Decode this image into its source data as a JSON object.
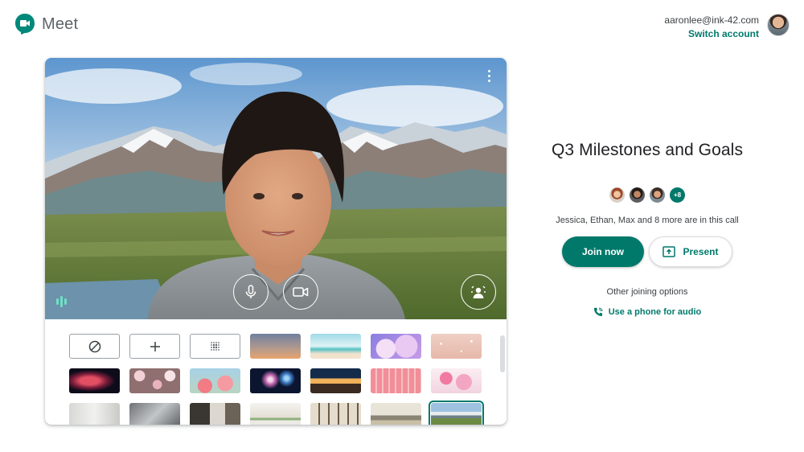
{
  "app": {
    "name": "Meet"
  },
  "account": {
    "email": "aaronlee@ink-42.com",
    "switch_label": "Switch account"
  },
  "preview": {
    "icons": {
      "more": "more-vert-icon",
      "mic": "mic-icon",
      "camera": "videocam-icon",
      "effects": "visual-effects-icon",
      "audio": "audio-level-icon"
    },
    "backgrounds": [
      [
        "no-effect-icon",
        "add-icon",
        "blur-icon",
        "dusk-sky",
        "beach",
        "purple-clouds",
        "pink-sparkles"
      ],
      [
        "nebula",
        "flowers",
        "pink-blossoms",
        "fireworks",
        "night-cabin",
        "pink-pattern",
        "cherry-blossom"
      ],
      [
        "white-room",
        "grey-office",
        "loft",
        "bright-room",
        "shelves",
        "safari",
        "mountains"
      ]
    ],
    "selected_background": "mountains"
  },
  "meeting": {
    "title": "Q3 Milestones and Goals",
    "more_count": "+8",
    "participants_text": "Jessica, Ethan, Max and 8 more are in this call",
    "join_label": "Join now",
    "present_label": "Present",
    "other_options_label": "Other joining options",
    "phone_label": "Use a phone for audio"
  },
  "colors": {
    "accent": "#00796b",
    "audio": "#6ee0c6"
  }
}
